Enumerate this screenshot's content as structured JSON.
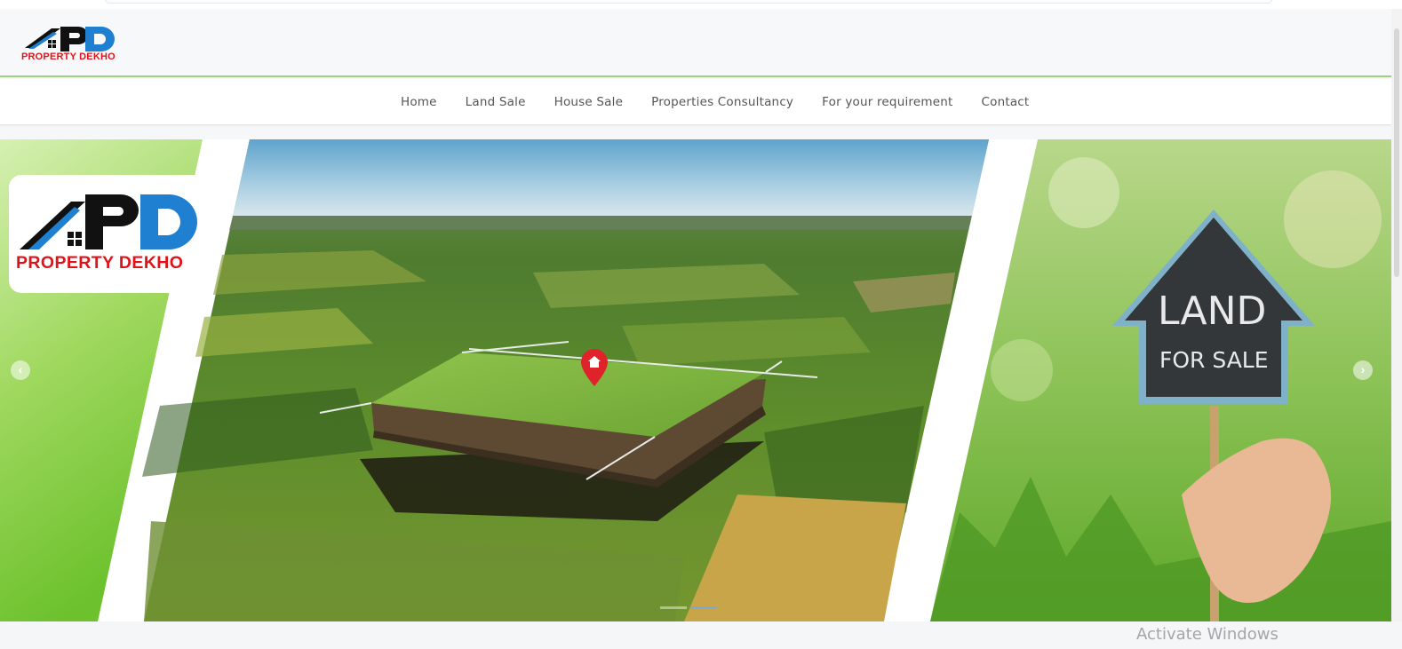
{
  "brand": {
    "name": "PROPERTY DEKHO",
    "monogram": "PD",
    "colors": {
      "red": "#e0131a",
      "blue": "#1f7fd0",
      "black": "#111111",
      "green": "#9bd37a"
    }
  },
  "nav": {
    "items": [
      {
        "label": "Home"
      },
      {
        "label": "Land Sale"
      },
      {
        "label": "House Sale"
      },
      {
        "label": "Properties Consultancy"
      },
      {
        "label": "For your requirement"
      },
      {
        "label": "Contact"
      }
    ]
  },
  "slider": {
    "prev_icon": "chevron-left-icon",
    "next_icon": "chevron-right-icon",
    "prev_glyph": "‹",
    "next_glyph": "›",
    "sign_line1": "LAND",
    "sign_line2": "FOR SALE",
    "pin_icon": "map-pin-icon",
    "slide_count": 2,
    "active_slide": 2
  },
  "os_watermark": "Activate Windows"
}
